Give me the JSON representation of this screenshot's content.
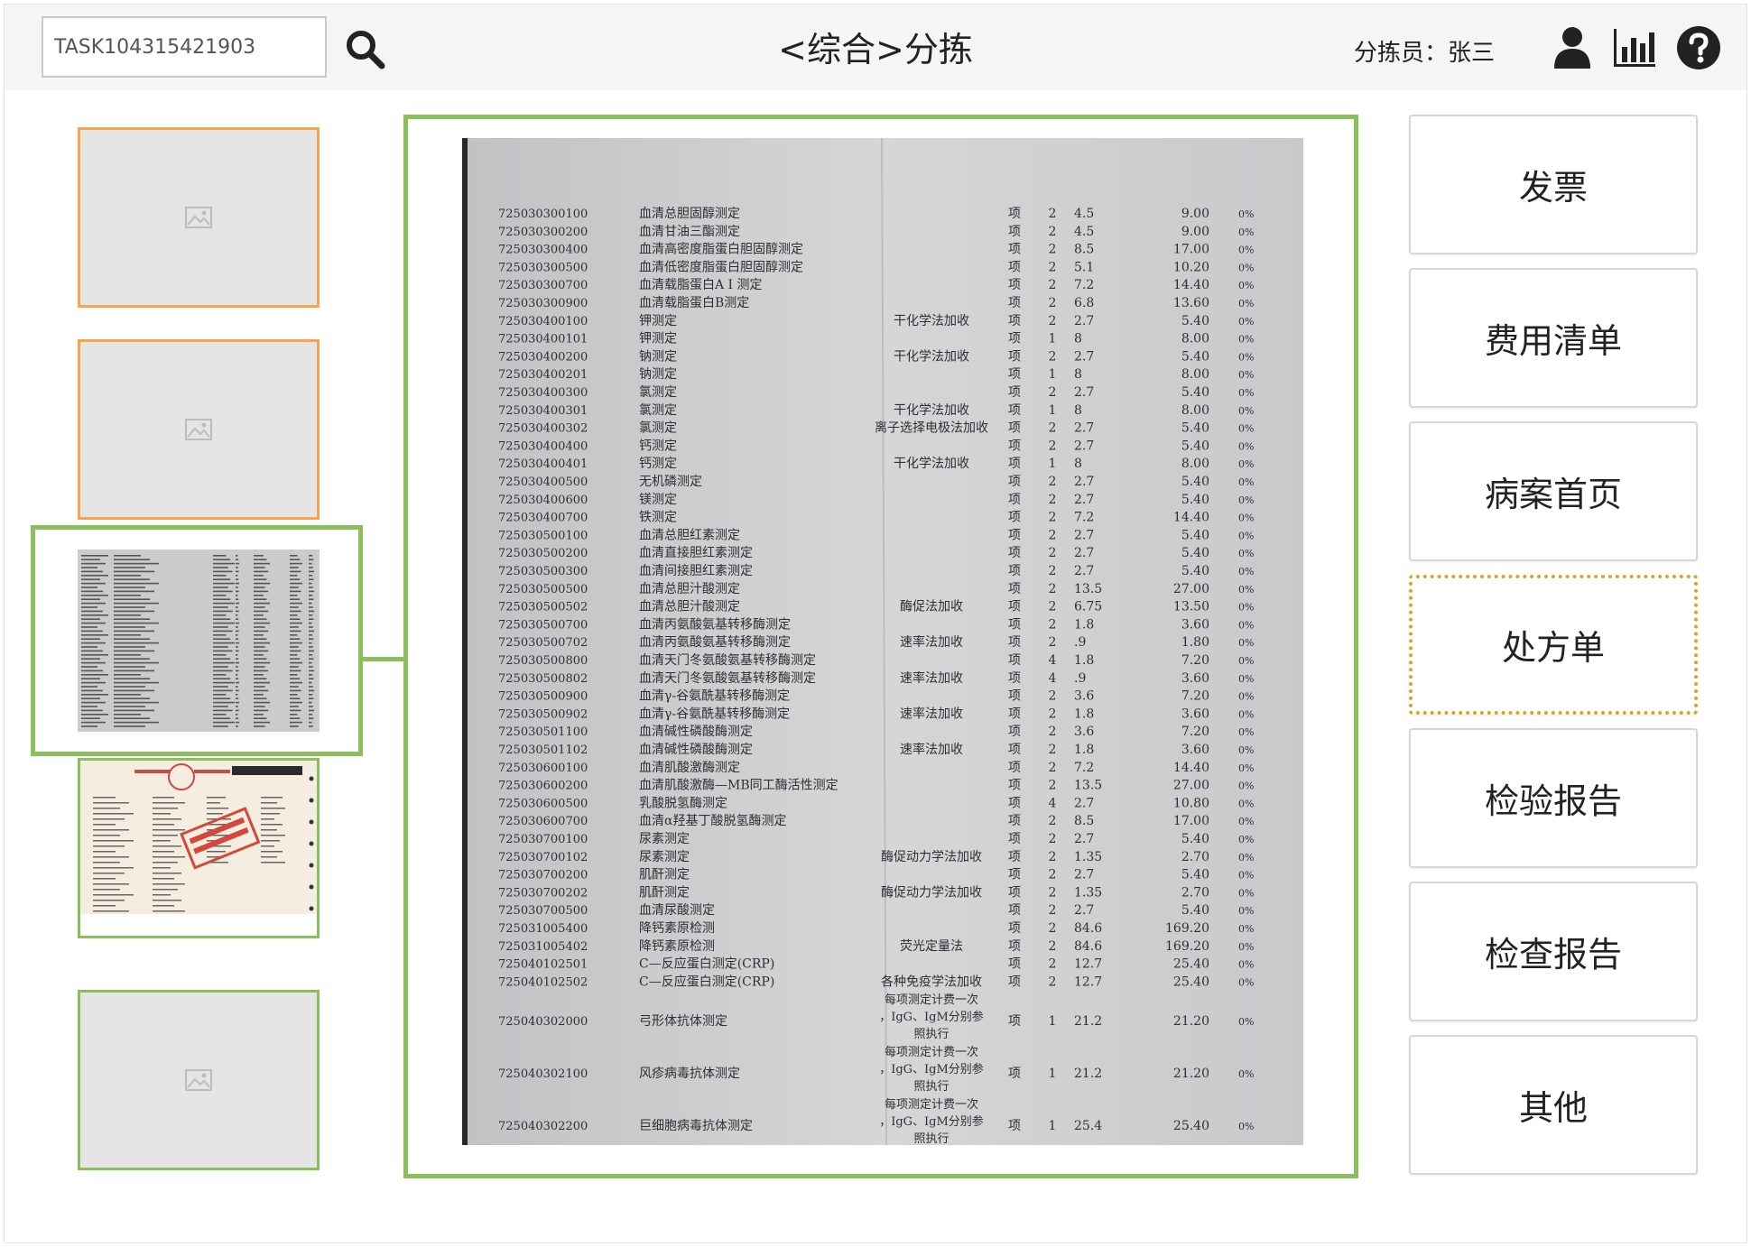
{
  "header": {
    "task_id": "TASK104315421903",
    "title": "<综合>分拣",
    "operator_label": "分拣员：张三"
  },
  "thumbnails": [
    {
      "kind": "placeholder",
      "status": "orange"
    },
    {
      "kind": "placeholder",
      "status": "orange"
    },
    {
      "kind": "prescription-scan",
      "status": "selected"
    },
    {
      "kind": "invoice-scan",
      "status": "green"
    },
    {
      "kind": "placeholder",
      "status": "green"
    }
  ],
  "document": {
    "rows": [
      {
        "code": "725030300100",
        "name": "血清总胆固醇测定",
        "method": "",
        "unit": "项",
        "qty": "2",
        "price": "4.5",
        "amount": "9.00",
        "ratio": "0%"
      },
      {
        "code": "725030300200",
        "name": "血清甘油三酯测定",
        "method": "",
        "unit": "项",
        "qty": "2",
        "price": "4.5",
        "amount": "9.00",
        "ratio": "0%"
      },
      {
        "code": "725030300400",
        "name": "血清高密度脂蛋白胆固醇测定",
        "method": "",
        "unit": "项",
        "qty": "2",
        "price": "8.5",
        "amount": "17.00",
        "ratio": "0%"
      },
      {
        "code": "725030300500",
        "name": "血清低密度脂蛋白胆固醇测定",
        "method": "",
        "unit": "项",
        "qty": "2",
        "price": "5.1",
        "amount": "10.20",
        "ratio": "0%"
      },
      {
        "code": "725030300700",
        "name": "血清载脂蛋白A I 测定",
        "method": "",
        "unit": "项",
        "qty": "2",
        "price": "7.2",
        "amount": "14.40",
        "ratio": "0%"
      },
      {
        "code": "725030300900",
        "name": "血清载脂蛋白B测定",
        "method": "",
        "unit": "项",
        "qty": "2",
        "price": "6.8",
        "amount": "13.60",
        "ratio": "0%"
      },
      {
        "code": "725030400100",
        "name": "钾测定",
        "method": "干化学法加收",
        "unit": "项",
        "qty": "2",
        "price": "2.7",
        "amount": "5.40",
        "ratio": "0%"
      },
      {
        "code": "725030400101",
        "name": "钾测定",
        "method": "",
        "unit": "项",
        "qty": "1",
        "price": "8",
        "amount": "8.00",
        "ratio": "0%"
      },
      {
        "code": "725030400200",
        "name": "钠测定",
        "method": "干化学法加收",
        "unit": "项",
        "qty": "2",
        "price": "2.7",
        "amount": "5.40",
        "ratio": "0%"
      },
      {
        "code": "725030400201",
        "name": "钠测定",
        "method": "",
        "unit": "项",
        "qty": "1",
        "price": "8",
        "amount": "8.00",
        "ratio": "0%"
      },
      {
        "code": "725030400300",
        "name": "氯测定",
        "method": "",
        "unit": "项",
        "qty": "2",
        "price": "2.7",
        "amount": "5.40",
        "ratio": "0%"
      },
      {
        "code": "725030400301",
        "name": "氯测定",
        "method": "干化学法加收",
        "unit": "项",
        "qty": "1",
        "price": "8",
        "amount": "8.00",
        "ratio": "0%"
      },
      {
        "code": "725030400302",
        "name": "氯测定",
        "method": "离子选择电极法加收",
        "unit": "项",
        "qty": "2",
        "price": "2.7",
        "amount": "5.40",
        "ratio": "0%"
      },
      {
        "code": "725030400400",
        "name": "钙测定",
        "method": "",
        "unit": "项",
        "qty": "2",
        "price": "2.7",
        "amount": "5.40",
        "ratio": "0%"
      },
      {
        "code": "725030400401",
        "name": "钙测定",
        "method": "干化学法加收",
        "unit": "项",
        "qty": "1",
        "price": "8",
        "amount": "8.00",
        "ratio": "0%"
      },
      {
        "code": "725030400500",
        "name": "无机磷测定",
        "method": "",
        "unit": "项",
        "qty": "2",
        "price": "2.7",
        "amount": "5.40",
        "ratio": "0%"
      },
      {
        "code": "725030400600",
        "name": "镁测定",
        "method": "",
        "unit": "项",
        "qty": "2",
        "price": "2.7",
        "amount": "5.40",
        "ratio": "0%"
      },
      {
        "code": "725030400700",
        "name": "铁测定",
        "method": "",
        "unit": "项",
        "qty": "2",
        "price": "7.2",
        "amount": "14.40",
        "ratio": "0%"
      },
      {
        "code": "725030500100",
        "name": "血清总胆红素测定",
        "method": "",
        "unit": "项",
        "qty": "2",
        "price": "2.7",
        "amount": "5.40",
        "ratio": "0%"
      },
      {
        "code": "725030500200",
        "name": "血清直接胆红素测定",
        "method": "",
        "unit": "项",
        "qty": "2",
        "price": "2.7",
        "amount": "5.40",
        "ratio": "0%"
      },
      {
        "code": "725030500300",
        "name": "血清间接胆红素测定",
        "method": "",
        "unit": "项",
        "qty": "2",
        "price": "2.7",
        "amount": "5.40",
        "ratio": "0%"
      },
      {
        "code": "725030500500",
        "name": "血清总胆汁酸测定",
        "method": "",
        "unit": "项",
        "qty": "2",
        "price": "13.5",
        "amount": "27.00",
        "ratio": "0%"
      },
      {
        "code": "725030500502",
        "name": "血清总胆汁酸测定",
        "method": "酶促法加收",
        "unit": "项",
        "qty": "2",
        "price": "6.75",
        "amount": "13.50",
        "ratio": "0%"
      },
      {
        "code": "725030500700",
        "name": "血清丙氨酸氨基转移酶测定",
        "method": "",
        "unit": "项",
        "qty": "2",
        "price": "1.8",
        "amount": "3.60",
        "ratio": "0%"
      },
      {
        "code": "725030500702",
        "name": "血清丙氨酸氨基转移酶测定",
        "method": "速率法加收",
        "unit": "项",
        "qty": "2",
        "price": ".9",
        "amount": "1.80",
        "ratio": "0%"
      },
      {
        "code": "725030500800",
        "name": "血清天门冬氨酸氨基转移酶测定",
        "method": "",
        "unit": "项",
        "qty": "4",
        "price": "1.8",
        "amount": "7.20",
        "ratio": "0%"
      },
      {
        "code": "725030500802",
        "name": "血清天门冬氨酸氨基转移酶测定",
        "method": "速率法加收",
        "unit": "项",
        "qty": "4",
        "price": ".9",
        "amount": "3.60",
        "ratio": "0%"
      },
      {
        "code": "725030500900",
        "name": "血清γ-谷氨酰基转移酶测定",
        "method": "",
        "unit": "项",
        "qty": "2",
        "price": "3.6",
        "amount": "7.20",
        "ratio": "0%"
      },
      {
        "code": "725030500902",
        "name": "血清γ-谷氨酰基转移酶测定",
        "method": "速率法加收",
        "unit": "项",
        "qty": "2",
        "price": "1.8",
        "amount": "3.60",
        "ratio": "0%"
      },
      {
        "code": "725030501100",
        "name": "血清碱性磷酸酶测定",
        "method": "",
        "unit": "项",
        "qty": "2",
        "price": "3.6",
        "amount": "7.20",
        "ratio": "0%"
      },
      {
        "code": "725030501102",
        "name": "血清碱性磷酸酶测定",
        "method": "速率法加收",
        "unit": "项",
        "qty": "2",
        "price": "1.8",
        "amount": "3.60",
        "ratio": "0%"
      },
      {
        "code": "725030600100",
        "name": "血清肌酸激酶测定",
        "method": "",
        "unit": "项",
        "qty": "2",
        "price": "7.2",
        "amount": "14.40",
        "ratio": "0%"
      },
      {
        "code": "725030600200",
        "name": "血清肌酸激酶—MB同工酶活性测定",
        "method": "",
        "unit": "项",
        "qty": "2",
        "price": "13.5",
        "amount": "27.00",
        "ratio": "0%"
      },
      {
        "code": "725030600500",
        "name": "乳酸脱氢酶测定",
        "method": "",
        "unit": "项",
        "qty": "4",
        "price": "2.7",
        "amount": "10.80",
        "ratio": "0%"
      },
      {
        "code": "725030600700",
        "name": "血清α羟基丁酸脱氢酶测定",
        "method": "",
        "unit": "项",
        "qty": "2",
        "price": "8.5",
        "amount": "17.00",
        "ratio": "0%"
      },
      {
        "code": "725030700100",
        "name": "尿素测定",
        "method": "",
        "unit": "项",
        "qty": "2",
        "price": "2.7",
        "amount": "5.40",
        "ratio": "0%"
      },
      {
        "code": "725030700102",
        "name": "尿素测定",
        "method": "酶促动力学法加收",
        "unit": "项",
        "qty": "2",
        "price": "1.35",
        "amount": "2.70",
        "ratio": "0%"
      },
      {
        "code": "725030700200",
        "name": "肌酐测定",
        "method": "",
        "unit": "项",
        "qty": "2",
        "price": "2.7",
        "amount": "5.40",
        "ratio": "0%"
      },
      {
        "code": "725030700202",
        "name": "肌酐测定",
        "method": "酶促动力学法加收",
        "unit": "项",
        "qty": "2",
        "price": "1.35",
        "amount": "2.70",
        "ratio": "0%"
      },
      {
        "code": "725030700500",
        "name": "血清尿酸测定",
        "method": "",
        "unit": "项",
        "qty": "2",
        "price": "2.7",
        "amount": "5.40",
        "ratio": "0%"
      },
      {
        "code": "725031005400",
        "name": "降钙素原检测",
        "method": "",
        "unit": "项",
        "qty": "2",
        "price": "84.6",
        "amount": "169.20",
        "ratio": "0%"
      },
      {
        "code": "725031005402",
        "name": "降钙素原检测",
        "method": "荧光定量法",
        "unit": "项",
        "qty": "2",
        "price": "84.6",
        "amount": "169.20",
        "ratio": "0%"
      },
      {
        "code": "725040102501",
        "name": "C—反应蛋白测定(CRP)",
        "method": "",
        "unit": "项",
        "qty": "2",
        "price": "12.7",
        "amount": "25.40",
        "ratio": "0%"
      },
      {
        "code": "725040102502",
        "name": "C—反应蛋白测定(CRP)",
        "method": "各种免疫学法加收",
        "unit": "项",
        "qty": "2",
        "price": "12.7",
        "amount": "25.40",
        "ratio": "0%"
      },
      {
        "code": "725040302000",
        "name": "弓形体抗体测定",
        "method": "每项测定计费一次，IgG、IgM分别参照执行",
        "unit": "项",
        "qty": "1",
        "price": "21.2",
        "amount": "21.20",
        "ratio": "0%"
      },
      {
        "code": "725040302100",
        "name": "风疹病毒抗体测定",
        "method": "每项测定计费一次，IgG、IgM分别参照执行",
        "unit": "项",
        "qty": "1",
        "price": "21.2",
        "amount": "21.20",
        "ratio": "0%"
      },
      {
        "code": "725040302200",
        "name": "巨细胞病毒抗体测定",
        "method": "每项测定计费一次，IgG、IgM分别参照执行",
        "unit": "项",
        "qty": "1",
        "price": "25.4",
        "amount": "25.40",
        "ratio": "0%"
      }
    ]
  },
  "categories": [
    {
      "label": "发票",
      "active": false
    },
    {
      "label": "费用清单",
      "active": false
    },
    {
      "label": "病案首页",
      "active": false
    },
    {
      "label": "处方单",
      "active": true
    },
    {
      "label": "检验报告",
      "active": false
    },
    {
      "label": "检查报告",
      "active": false
    },
    {
      "label": "其他",
      "active": false
    }
  ],
  "colors": {
    "selected_green": "#8bbf5c",
    "pending_orange": "#f5a54a",
    "active_gold": "#d8a32a"
  }
}
